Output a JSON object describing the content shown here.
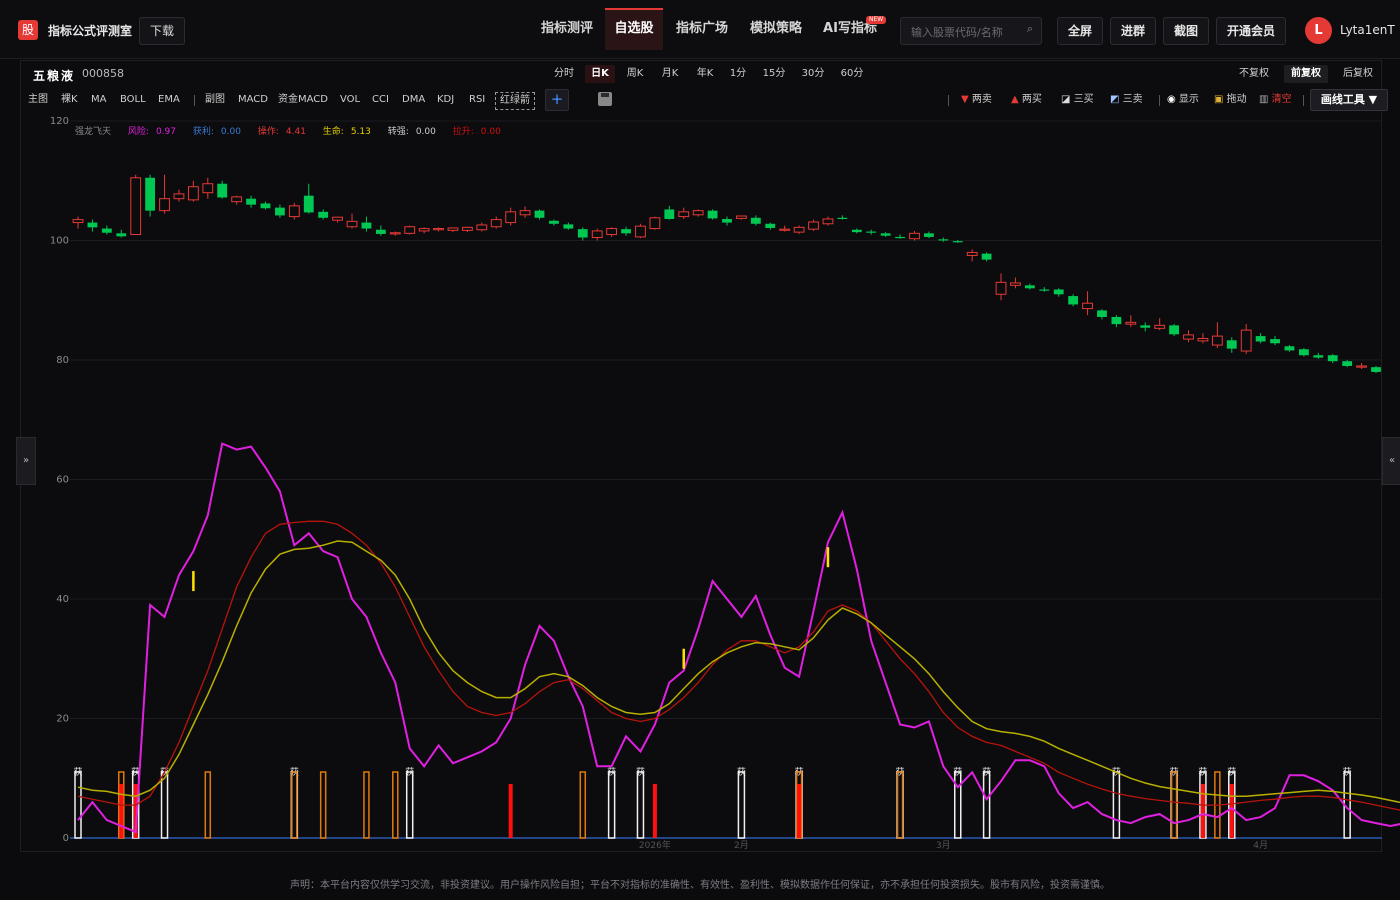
{
  "header": {
    "brand": "指标公式评测室",
    "download": "下载",
    "nav": [
      "指标测评",
      "自选股",
      "指标广场",
      "模拟策略",
      "AI写指标"
    ],
    "new_badge": "NEW",
    "search_placeholder": "输入股票代码/名称",
    "fullscreen": "全屏",
    "join_group": "进群",
    "screenshot": "截图",
    "vip": "开通会员",
    "avatar_letter": "L",
    "username": "Lyta1enT"
  },
  "stock": {
    "name": "五粮液",
    "code": "000858",
    "periods": [
      "分时",
      "日K",
      "周K",
      "月K",
      "年K",
      "1分",
      "15分",
      "30分",
      "60分"
    ],
    "active_period": "日K",
    "adjust": [
      "不复权",
      "前复权",
      "后复权"
    ],
    "active_adjust": "前复权"
  },
  "indicators": [
    "主图",
    "裸K",
    "MA",
    "BOLL",
    "EMA",
    "副图",
    "MACD",
    "资金MACD",
    "VOL",
    "CCI",
    "DMA",
    "KDJ",
    "RSI",
    "红绿箭"
  ],
  "draw": {
    "tools": [
      "两卖",
      "两买",
      "三买",
      "三卖",
      "显示",
      "拖动",
      "清空"
    ],
    "menu": "画线工具 ▼"
  },
  "legend": [
    {
      "label": "强龙飞天",
      "value": "",
      "color": "#8a8a8a"
    },
    {
      "label": "风险:",
      "value": "0.97",
      "color": "#e020e0"
    },
    {
      "label": "获利:",
      "value": "0.00",
      "color": "#3a7bd5"
    },
    {
      "label": "操作:",
      "value": "4.41",
      "color": "#e53935"
    },
    {
      "label": "生命:",
      "value": "5.13",
      "color": "#e6d200"
    },
    {
      "label": "转强:",
      "value": "0.00",
      "color": "#cfcfcf"
    },
    {
      "label": "拉升:",
      "value": "0.00",
      "color": "#d01010"
    }
  ],
  "colors": {
    "up": "#e53935",
    "down": "#00c853",
    "risk": "#e020e0",
    "operate": "#c0140c",
    "life": "#c8c000"
  },
  "chart_data": {
    "type": "candlestick",
    "ylim": [
      0,
      120
    ],
    "yticks": [
      0,
      20,
      40,
      60,
      80,
      100,
      120
    ],
    "xlabels": [
      {
        "label": "2026年",
        "index": 40
      },
      {
        "label": "2月",
        "index": 46
      },
      {
        "label": "3月",
        "index": 60
      },
      {
        "label": "4月",
        "index": 82
      }
    ],
    "candles": [
      {
        "o": 103,
        "h": 104,
        "l": 102,
        "c": 103.5
      },
      {
        "o": 103,
        "h": 103.5,
        "l": 101.5,
        "c": 102.2
      },
      {
        "o": 102,
        "h": 102.5,
        "l": 101,
        "c": 101.3
      },
      {
        "o": 101.2,
        "h": 101.8,
        "l": 100.5,
        "c": 100.7
      },
      {
        "o": 101,
        "h": 111,
        "l": 101,
        "c": 110.5
      },
      {
        "o": 110.5,
        "h": 111,
        "l": 104,
        "c": 105
      },
      {
        "o": 105,
        "h": 111,
        "l": 104.5,
        "c": 107
      },
      {
        "o": 107,
        "h": 108.5,
        "l": 106.5,
        "c": 107.8
      },
      {
        "o": 106.8,
        "h": 110,
        "l": 106.5,
        "c": 109
      },
      {
        "o": 108,
        "h": 110.5,
        "l": 107,
        "c": 109.5
      },
      {
        "o": 109.5,
        "h": 110,
        "l": 107,
        "c": 107.2
      },
      {
        "o": 106.5,
        "h": 107.5,
        "l": 106,
        "c": 107.3
      },
      {
        "o": 107,
        "h": 107.5,
        "l": 105.5,
        "c": 106
      },
      {
        "o": 106.2,
        "h": 106.5,
        "l": 105.2,
        "c": 105.4
      },
      {
        "o": 105.5,
        "h": 106,
        "l": 103.8,
        "c": 104.2
      },
      {
        "o": 104,
        "h": 106.3,
        "l": 103.5,
        "c": 105.8
      },
      {
        "o": 107.5,
        "h": 109.5,
        "l": 104.5,
        "c": 104.7
      },
      {
        "o": 104.8,
        "h": 105.2,
        "l": 103.5,
        "c": 103.8
      },
      {
        "o": 103.4,
        "h": 104,
        "l": 103,
        "c": 103.9
      },
      {
        "o": 102.3,
        "h": 104.5,
        "l": 102,
        "c": 103.2
      },
      {
        "o": 103,
        "h": 104,
        "l": 101.5,
        "c": 102
      },
      {
        "o": 101.8,
        "h": 102.5,
        "l": 100.8,
        "c": 101.1
      },
      {
        "o": 101.1,
        "h": 101.5,
        "l": 100.8,
        "c": 101.3
      },
      {
        "o": 101.2,
        "h": 102.5,
        "l": 101,
        "c": 102.3
      },
      {
        "o": 101.6,
        "h": 102.2,
        "l": 101.2,
        "c": 102
      },
      {
        "o": 101.8,
        "h": 102.2,
        "l": 101.5,
        "c": 102
      },
      {
        "o": 101.7,
        "h": 102.2,
        "l": 101.4,
        "c": 102.1
      },
      {
        "o": 101.7,
        "h": 102.3,
        "l": 101.4,
        "c": 102.2
      },
      {
        "o": 101.8,
        "h": 103,
        "l": 101.5,
        "c": 102.6
      },
      {
        "o": 102.3,
        "h": 104,
        "l": 102,
        "c": 103.5
      },
      {
        "o": 103,
        "h": 105.5,
        "l": 102.5,
        "c": 104.8
      },
      {
        "o": 104.3,
        "h": 105.7,
        "l": 103.8,
        "c": 105
      },
      {
        "o": 105,
        "h": 105.2,
        "l": 103.5,
        "c": 103.8
      },
      {
        "o": 103.3,
        "h": 103.5,
        "l": 102.5,
        "c": 102.8
      },
      {
        "o": 102.7,
        "h": 103,
        "l": 101.8,
        "c": 102
      },
      {
        "o": 101.9,
        "h": 102.2,
        "l": 100,
        "c": 100.5
      },
      {
        "o": 100.5,
        "h": 102,
        "l": 100,
        "c": 101.6
      },
      {
        "o": 101,
        "h": 102.2,
        "l": 100.6,
        "c": 102
      },
      {
        "o": 101.9,
        "h": 102.3,
        "l": 100.8,
        "c": 101.2
      },
      {
        "o": 100.6,
        "h": 102.8,
        "l": 100.4,
        "c": 102.4
      },
      {
        "o": 102,
        "h": 104,
        "l": 101.8,
        "c": 103.8
      },
      {
        "o": 105.2,
        "h": 105.8,
        "l": 103.5,
        "c": 103.6
      },
      {
        "o": 104,
        "h": 105.5,
        "l": 103.6,
        "c": 104.8
      },
      {
        "o": 104.3,
        "h": 105.2,
        "l": 104,
        "c": 105
      },
      {
        "o": 105,
        "h": 105.2,
        "l": 103.5,
        "c": 103.7
      },
      {
        "o": 103.6,
        "h": 104,
        "l": 102.5,
        "c": 103
      },
      {
        "o": 103.7,
        "h": 104.2,
        "l": 103.5,
        "c": 104.1
      },
      {
        "o": 103.8,
        "h": 104.2,
        "l": 102.5,
        "c": 102.8
      },
      {
        "o": 102.8,
        "h": 103,
        "l": 101.8,
        "c": 102.1
      },
      {
        "o": 101.8,
        "h": 102.5,
        "l": 101.5,
        "c": 101.9
      },
      {
        "o": 101.4,
        "h": 102.5,
        "l": 101.1,
        "c": 102.2
      },
      {
        "o": 101.9,
        "h": 103.5,
        "l": 101.6,
        "c": 103.1
      },
      {
        "o": 102.8,
        "h": 104,
        "l": 102.5,
        "c": 103.6
      },
      {
        "o": 103.8,
        "h": 104.2,
        "l": 103.5,
        "c": 103.6
      },
      {
        "o": 101.8,
        "h": 102,
        "l": 101.2,
        "c": 101.4
      },
      {
        "o": 101.5,
        "h": 101.8,
        "l": 101,
        "c": 101.3
      },
      {
        "o": 101.2,
        "h": 101.4,
        "l": 100.6,
        "c": 100.8
      },
      {
        "o": 100.6,
        "h": 101,
        "l": 100.3,
        "c": 100.5
      },
      {
        "o": 100.3,
        "h": 101.6,
        "l": 100,
        "c": 101.2
      },
      {
        "o": 101.2,
        "h": 101.5,
        "l": 100.4,
        "c": 100.6
      },
      {
        "o": 100.2,
        "h": 100.5,
        "l": 99.8,
        "c": 100
      },
      {
        "o": 99.9,
        "h": 100.1,
        "l": 99.6,
        "c": 99.8
      },
      {
        "o": 97.5,
        "h": 98.5,
        "l": 96.5,
        "c": 98
      },
      {
        "o": 97.8,
        "h": 98,
        "l": 96.5,
        "c": 96.8
      },
      {
        "o": 91,
        "h": 94.5,
        "l": 90,
        "c": 93
      },
      {
        "o": 92.5,
        "h": 93.8,
        "l": 92,
        "c": 92.9
      },
      {
        "o": 92.5,
        "h": 92.8,
        "l": 91.8,
        "c": 92
      },
      {
        "o": 91.8,
        "h": 92.2,
        "l": 91.4,
        "c": 91.6
      },
      {
        "o": 91.8,
        "h": 92,
        "l": 90.6,
        "c": 91
      },
      {
        "o": 90.7,
        "h": 91,
        "l": 89,
        "c": 89.3
      },
      {
        "o": 88.6,
        "h": 91.5,
        "l": 87.5,
        "c": 89.5
      },
      {
        "o": 88.3,
        "h": 88.5,
        "l": 86.8,
        "c": 87.2
      },
      {
        "o": 87.2,
        "h": 87.5,
        "l": 85.5,
        "c": 86
      },
      {
        "o": 86,
        "h": 87.5,
        "l": 85.5,
        "c": 86.3
      },
      {
        "o": 85.8,
        "h": 86.3,
        "l": 84.8,
        "c": 85.4
      },
      {
        "o": 85.3,
        "h": 87,
        "l": 85,
        "c": 85.8
      },
      {
        "o": 85.8,
        "h": 86,
        "l": 84,
        "c": 84.3
      },
      {
        "o": 83.5,
        "h": 85,
        "l": 83,
        "c": 84.2
      },
      {
        "o": 83.2,
        "h": 84.5,
        "l": 82.8,
        "c": 83.6
      },
      {
        "o": 82.5,
        "h": 86.3,
        "l": 82,
        "c": 84
      },
      {
        "o": 83.3,
        "h": 83.8,
        "l": 81.2,
        "c": 81.9
      },
      {
        "o": 81.5,
        "h": 86,
        "l": 81,
        "c": 85
      },
      {
        "o": 84,
        "h": 84.5,
        "l": 82.8,
        "c": 83.1
      },
      {
        "o": 83.5,
        "h": 84,
        "l": 82.5,
        "c": 82.8
      },
      {
        "o": 82.3,
        "h": 82.5,
        "l": 81.4,
        "c": 81.6
      },
      {
        "o": 81.8,
        "h": 82,
        "l": 80.6,
        "c": 80.8
      },
      {
        "o": 80.8,
        "h": 81.2,
        "l": 80.2,
        "c": 80.4
      },
      {
        "o": 80.8,
        "h": 81,
        "l": 79.5,
        "c": 79.8
      },
      {
        "o": 79.8,
        "h": 80,
        "l": 78.8,
        "c": 79
      },
      {
        "o": 78.8,
        "h": 79.5,
        "l": 78.5,
        "c": 79
      },
      {
        "o": 78.8,
        "h": 79,
        "l": 77.8,
        "c": 78
      }
    ],
    "series": [
      {
        "name": "风险",
        "values": [
          3,
          6,
          3,
          2,
          1,
          39,
          37,
          44,
          48,
          54,
          66,
          65,
          65.5,
          62,
          58,
          49,
          51,
          48,
          47,
          40,
          37,
          31,
          26,
          15,
          12,
          15.5,
          12.5,
          13.5,
          14.5,
          16,
          20,
          29,
          35.5,
          33,
          27,
          22,
          12,
          12,
          17,
          14.5,
          19,
          26,
          28,
          35,
          43,
          40,
          37,
          40.5,
          34,
          28.5,
          27,
          38,
          49.5,
          54.5,
          45,
          33,
          26,
          19,
          18.5,
          19.5,
          12,
          8.5,
          11,
          6.5,
          9.5,
          13,
          13,
          12,
          7.5,
          5,
          6,
          4,
          3,
          2.5,
          3.5,
          4,
          2.5,
          3,
          4,
          3.5,
          5,
          3,
          3.5,
          5,
          10.5,
          10.5,
          9.5,
          8,
          5,
          3,
          2.5,
          2,
          2.5,
          1
        ]
      },
      {
        "name": "操作",
        "values": [
          7,
          6.5,
          6,
          5.5,
          5.5,
          7,
          11,
          16,
          22,
          28,
          35,
          42,
          47,
          51,
          52.5,
          52.8,
          53,
          53,
          52.5,
          51,
          49,
          46,
          42,
          37,
          32,
          28,
          24.5,
          22,
          21,
          20.5,
          21,
          22.5,
          24.5,
          26,
          26.5,
          25,
          23,
          21,
          20,
          19.5,
          20,
          21.5,
          23.5,
          26,
          29,
          31.5,
          33,
          33,
          32,
          31,
          32,
          34.5,
          38,
          39,
          38,
          36,
          33,
          30,
          27.5,
          24.5,
          21,
          18.5,
          17,
          16,
          15.5,
          14.5,
          13.5,
          12.5,
          11,
          10,
          9,
          8.2,
          7.5,
          7,
          6.6,
          6.3,
          6,
          5.8,
          5.5,
          5.5,
          5.7,
          6,
          6.3,
          6.5,
          6.8,
          7,
          7,
          6.8,
          6.4,
          6,
          5.5,
          5,
          4.5,
          4
        ]
      },
      {
        "name": "生命",
        "values": [
          8.5,
          8,
          7.8,
          7.3,
          7,
          8,
          10,
          14,
          19,
          24,
          29.5,
          35.5,
          41,
          45,
          47.5,
          48.3,
          48.5,
          49,
          49.7,
          49.5,
          48,
          46.5,
          44,
          40,
          35,
          31,
          28,
          26,
          24.5,
          23.5,
          23.5,
          25,
          27,
          27.5,
          27,
          25.5,
          23.5,
          22,
          21,
          20.7,
          21,
          22.5,
          25,
          27.5,
          29.5,
          31,
          32,
          32.7,
          32.5,
          32,
          31.5,
          33.5,
          36.5,
          38.5,
          37.5,
          36,
          34,
          32,
          30,
          27.5,
          24.5,
          21.8,
          19.5,
          18.3,
          17.8,
          17.5,
          17,
          16.2,
          15,
          14,
          13,
          12,
          11,
          10,
          9.2,
          8.6,
          8.2,
          7.8,
          7.4,
          7.2,
          7,
          7,
          7.2,
          7.4,
          7.6,
          7.8,
          8,
          7.8,
          7.5,
          7.2,
          6.8,
          6.3,
          5.8,
          5.3
        ]
      }
    ],
    "signal_flags": [
      {
        "i": 0,
        "color": "white"
      },
      {
        "i": 4,
        "color": "white"
      },
      {
        "i": 6,
        "color": "white"
      },
      {
        "i": 15,
        "color": "white"
      },
      {
        "i": 23,
        "color": "white"
      },
      {
        "i": 37,
        "color": "white"
      },
      {
        "i": 39,
        "color": "white"
      },
      {
        "i": 46,
        "color": "white"
      },
      {
        "i": 50,
        "color": "white"
      },
      {
        "i": 57,
        "color": "white"
      },
      {
        "i": 61,
        "color": "white"
      },
      {
        "i": 63,
        "color": "white"
      },
      {
        "i": 72,
        "color": "white"
      },
      {
        "i": 76,
        "color": "white"
      },
      {
        "i": 78,
        "color": "white"
      },
      {
        "i": 80,
        "color": "white"
      },
      {
        "i": 88,
        "color": "white"
      }
    ],
    "signal_flag_text": "获",
    "orange_bars": [
      3,
      9,
      15,
      17,
      20,
      22,
      35,
      50,
      57,
      76,
      79
    ],
    "red_bars": [
      3,
      4,
      30,
      40,
      50,
      78,
      80
    ],
    "yellow_marks": [
      {
        "i": 8,
        "y": 43
      },
      {
        "i": 42,
        "y": 30
      },
      {
        "i": 52,
        "y": 47
      }
    ]
  },
  "disclaimer": "声明：本平台内容仅供学习交流，非投资建议。用户操作风险自担；平台不对指标的准确性、有效性、盈利性、模拟数据作任何保证，亦不承担任何投资损失。股市有风险，投资需谨慎。"
}
